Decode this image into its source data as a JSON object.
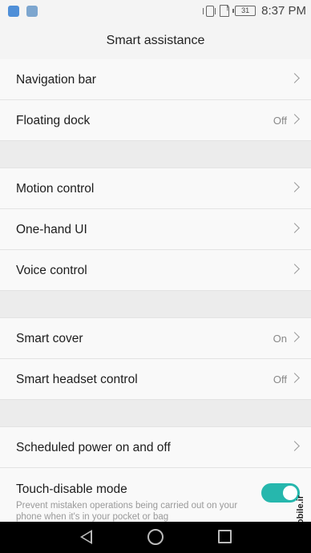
{
  "status_bar": {
    "battery": "31",
    "time": "8:37 PM"
  },
  "title": "Smart assistance",
  "items": [
    {
      "label": "Navigation bar",
      "value": ""
    },
    {
      "label": "Floating dock",
      "value": "Off"
    },
    {
      "label": "Motion control",
      "value": ""
    },
    {
      "label": "One-hand UI",
      "value": ""
    },
    {
      "label": "Voice control",
      "value": ""
    },
    {
      "label": "Smart cover",
      "value": "On"
    },
    {
      "label": "Smart headset control",
      "value": "Off"
    },
    {
      "label": "Scheduled power on and off",
      "value": ""
    }
  ],
  "touch_disable": {
    "label": "Touch-disable mode",
    "description": "Prevent mistaken operations being carried out on your phone when it's in your pocket or bag",
    "enabled": true
  },
  "watermark": "mobile.ir",
  "colors": {
    "toggle_on": "#26b7ad",
    "background": "#f4f4f4"
  }
}
